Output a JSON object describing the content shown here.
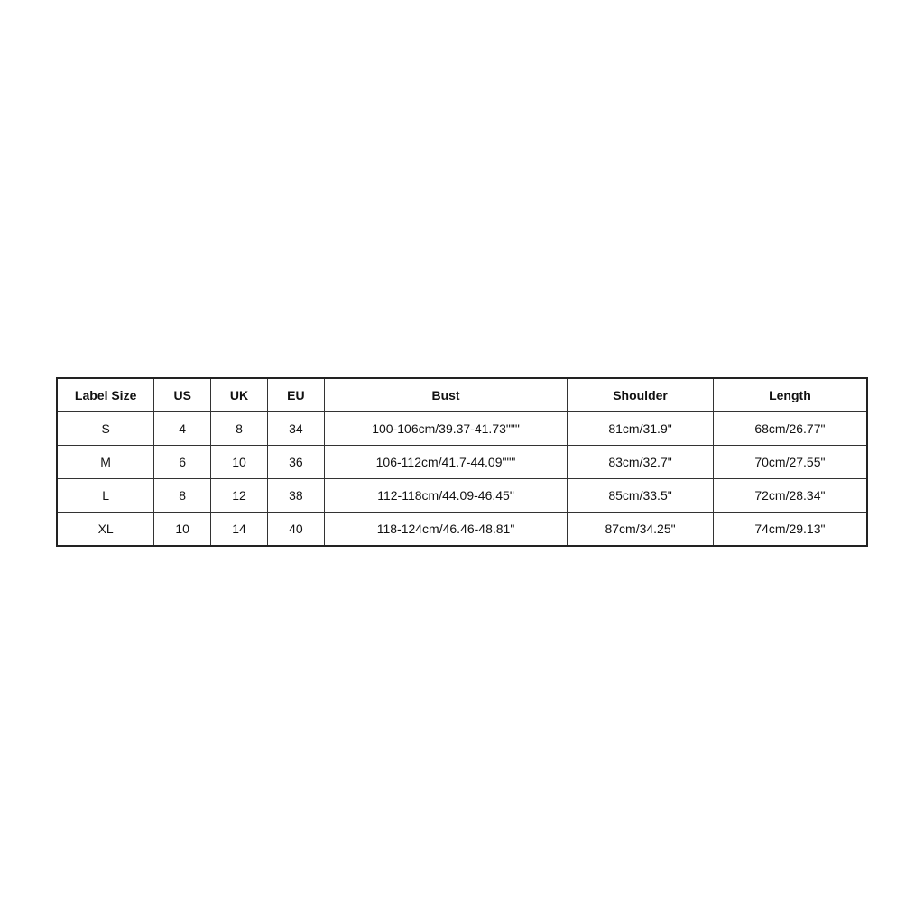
{
  "table": {
    "headers": {
      "label_size": "Label Size",
      "us": "US",
      "uk": "UK",
      "eu": "EU",
      "bust": "Bust",
      "shoulder": "Shoulder",
      "length": "Length"
    },
    "rows": [
      {
        "label": "S",
        "us": "4",
        "uk": "8",
        "eu": "34",
        "bust": "100-106cm/39.37-41.73\"\"\"",
        "shoulder": "81cm/31.9\"",
        "length": "68cm/26.77\""
      },
      {
        "label": "M",
        "us": "6",
        "uk": "10",
        "eu": "36",
        "bust": "106-112cm/41.7-44.09\"\"\"",
        "shoulder": "83cm/32.7\"",
        "length": "70cm/27.55\""
      },
      {
        "label": "L",
        "us": "8",
        "uk": "12",
        "eu": "38",
        "bust": "112-118cm/44.09-46.45\"",
        "shoulder": "85cm/33.5\"",
        "length": "72cm/28.34\""
      },
      {
        "label": "XL",
        "us": "10",
        "uk": "14",
        "eu": "40",
        "bust": "118-124cm/46.46-48.81\"",
        "shoulder": "87cm/34.25\"",
        "length": "74cm/29.13\""
      }
    ]
  }
}
